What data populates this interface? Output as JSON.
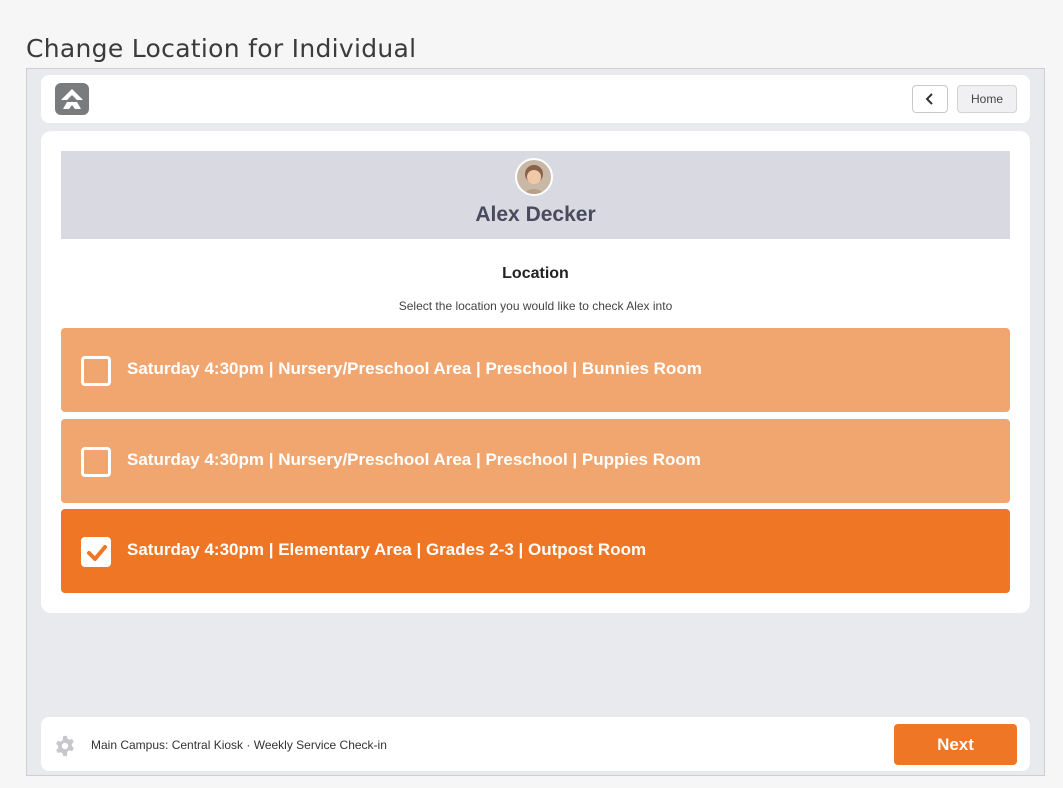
{
  "page": {
    "heading": "Change Location for Individual"
  },
  "header": {
    "logo_icon": "rock-logo-icon",
    "back_icon": "chevron-left-icon",
    "home_label": "Home"
  },
  "person": {
    "name": "Alex Decker",
    "avatar_icon": "avatar-photo"
  },
  "location": {
    "title": "Location",
    "subtitle": "Select the location you would like to check Alex into",
    "options": [
      {
        "label": "Saturday 4:30pm | Nursery/Preschool Area | Preschool | Bunnies Room",
        "selected": false
      },
      {
        "label": "Saturday 4:30pm | Nursery/Preschool Area | Preschool | Puppies Room",
        "selected": false
      },
      {
        "label": "Saturday 4:30pm | Elementary Area | Grades 2-3 | Outpost Room",
        "selected": true
      }
    ]
  },
  "footer": {
    "settings_icon": "gear-icon",
    "kiosk_text": "Main Campus: Central Kiosk · Weekly Service Check-in",
    "next_label": "Next"
  },
  "colors": {
    "accent": "#ee7625",
    "option_unselected": "#f2a66f",
    "person_panel": "#d9d9e2"
  }
}
